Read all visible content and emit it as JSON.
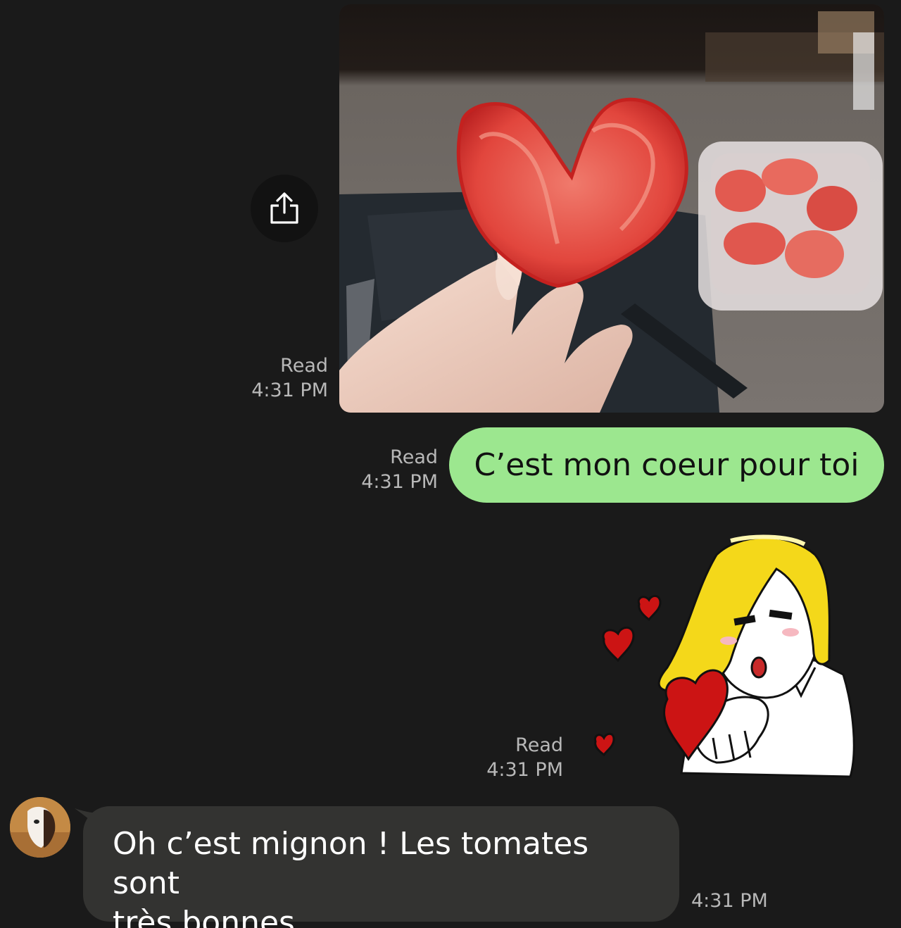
{
  "messages": [
    {
      "direction": "outgoing",
      "kind": "photo",
      "photo_description": "hand holding heart-shaped tomato slice",
      "status": "Read",
      "time": "4:31 PM"
    },
    {
      "direction": "outgoing",
      "kind": "text",
      "text": "C’est mon coeur pour toi",
      "status": "Read",
      "time": "4:31 PM"
    },
    {
      "direction": "outgoing",
      "kind": "sticker",
      "sticker_description": "blonde cartoon character blowing kiss with hearts",
      "status": "Read",
      "time": "4:31 PM"
    },
    {
      "direction": "incoming",
      "kind": "text",
      "text_line1": "Oh c’est mignon ! Les tomates sont",
      "text_line2": "très bonnes",
      "time": "4:31 PM"
    }
  ],
  "icons": {
    "share": "share-icon",
    "avatar": "avatar"
  },
  "colors": {
    "background": "#1a1a1a",
    "outgoing_bubble": "#9ce78f",
    "incoming_bubble": "#333331",
    "meta_text": "#b8b8b8"
  }
}
